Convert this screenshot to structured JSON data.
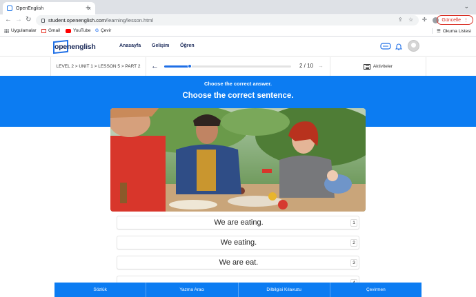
{
  "browser": {
    "tab_title": "OpenEnglish",
    "tab_close": "×",
    "new_tab": "+",
    "url_domain": "student.openenglish.com",
    "url_path": "/learning/lesson.html",
    "update_label": "Güncelle",
    "bookmarks": [
      {
        "label": "Uygulamalar",
        "icon": "apps-grid-icon",
        "color": "#5f6368"
      },
      {
        "label": "Gmail",
        "icon": "gmail-icon",
        "color": "#ea4335"
      },
      {
        "label": "YouTube",
        "icon": "youtube-icon",
        "color": "#ff0000"
      },
      {
        "label": "Çevir",
        "icon": "google-icon",
        "color": "#4285f4"
      }
    ],
    "reading_list": "Okuma Listesi"
  },
  "header": {
    "logo_text": "openenglish",
    "nav": [
      "Anasayfa",
      "Gelişim",
      "Öğren"
    ],
    "icons": [
      "chat-icon",
      "bell-icon",
      "user-avatar"
    ]
  },
  "lesson": {
    "breadcrumb": "LEVEL 2 > UNIT 1 > LESSON 5 > PART 2",
    "page_counter": "2 / 10",
    "progress": 0.2,
    "activities_label": "Aktiviteler"
  },
  "question": {
    "instruction": "Choose the correct answer.",
    "prompt": "Choose the correct sentence."
  },
  "options": [
    {
      "text": "We are eating.",
      "num": "1"
    },
    {
      "text": "We eating.",
      "num": "2"
    },
    {
      "text": "We are eat.",
      "num": "3"
    },
    {
      "text": "",
      "num": "4"
    }
  ],
  "bottom_bar": [
    "Sözlük",
    "Yazma Aracı",
    "Dilbilgisi Kılavuzu",
    "Çevirmen"
  ],
  "colors": {
    "brand_blue": "#0c7cf2",
    "logo_navy": "#1c2b5a",
    "update_red": "#d93025"
  }
}
